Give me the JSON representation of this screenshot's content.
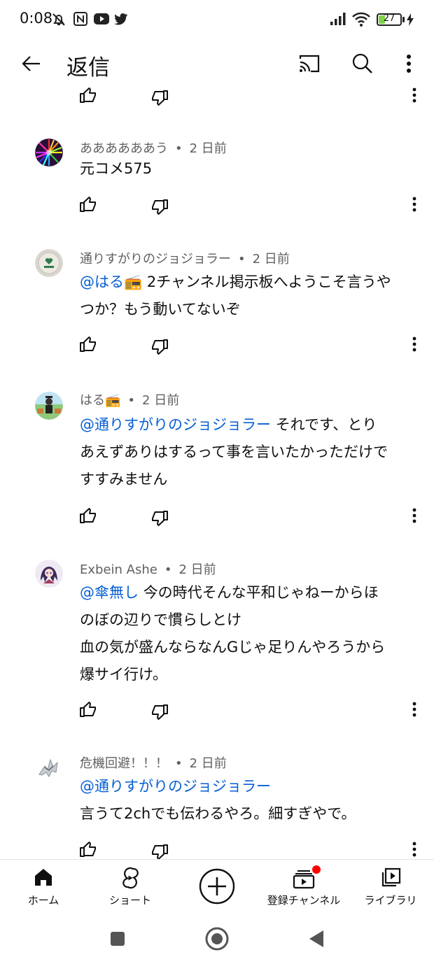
{
  "status_bar": {
    "time": "0:08",
    "battery": "27",
    "battery_level": 0.27,
    "icons": [
      "mute-bell-icon",
      "nfc-icon",
      "youtube-icon",
      "twitter-icon",
      "signal-icon",
      "wifi-icon",
      "battery-icon",
      "charging-icon"
    ]
  },
  "header": {
    "title": "返信",
    "icons": [
      "back-arrow-icon",
      "cast-icon",
      "search-icon",
      "more-vert-icon"
    ]
  },
  "comments": [
    {
      "author": "ああああああう",
      "time": "2 日前",
      "mention": "",
      "lines": [
        "元コメ575"
      ]
    },
    {
      "author": "通りすがりのジョジョラー",
      "time": "2 日前",
      "mention": "@はる📻",
      "lines": [
        "2チャンネル掲示板へようこそ言うや",
        "つか？もう動いてないぞ"
      ]
    },
    {
      "author": "はる📻",
      "time": "2 日前",
      "mention": "@通りすがりのジョジョラー",
      "lines": [
        "それです、とり",
        "あえずありはするって事を言いたかっただけで",
        "すすみません"
      ]
    },
    {
      "author": "Exbein Ashe",
      "time": "2 日前",
      "mention": "@傘無し",
      "lines": [
        "今の時代そんな平和じゃねーからほ",
        "のぼの辺りで慣らしとけ",
        "血の気が盛んならなんGじゃ足りんやろうから",
        "爆サイ行け。"
      ]
    },
    {
      "author": "危機回避！！！",
      "time": "2 日前",
      "mention": "@通りすがりのジョジョラー",
      "lines": [
        "",
        "言うて2chでも伝わるやろ。細すぎやで。"
      ]
    }
  ],
  "bottom_nav": {
    "items": [
      {
        "label": "ホーム",
        "icon": "home-icon"
      },
      {
        "label": "ショート",
        "icon": "shorts-icon"
      },
      {
        "label": "",
        "icon": "create-plus-icon"
      },
      {
        "label": "登録チャンネル",
        "icon": "subscriptions-icon"
      },
      {
        "label": "ライブラリ",
        "icon": "library-icon"
      }
    ]
  },
  "system_nav": {
    "icons": [
      "recents-square-icon",
      "home-circle-icon",
      "back-triangle-icon"
    ]
  },
  "colors": {
    "mention": "#065fd4",
    "meta": "#606060",
    "text": "#0f0f0f",
    "notif": "#ff0000",
    "battery": "#7fd34a"
  }
}
